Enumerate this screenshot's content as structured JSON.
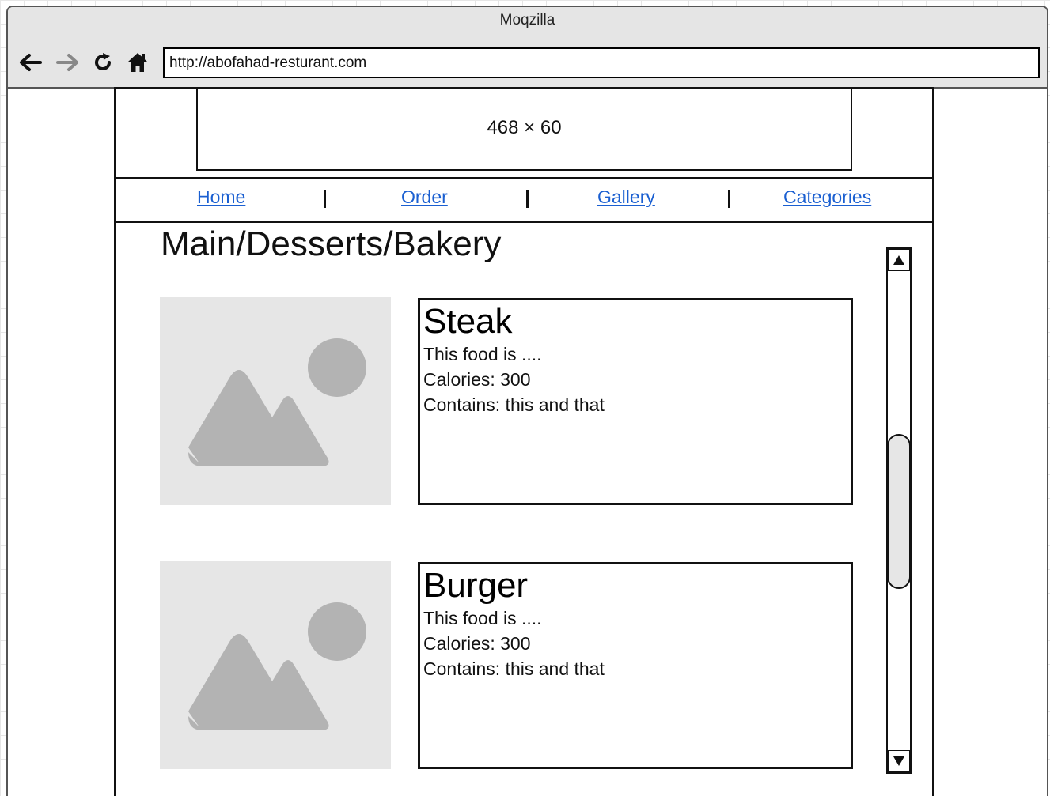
{
  "window": {
    "title": "Moqzilla"
  },
  "toolbar": {
    "back_icon": "back-arrow-icon",
    "forward_icon": "forward-arrow-icon",
    "reload_icon": "reload-icon",
    "home_icon": "home-icon",
    "url": "http://abofahad-resturant.com"
  },
  "banner": {
    "label": "468 × 60"
  },
  "nav": {
    "items": [
      {
        "label": "Home"
      },
      {
        "label": "Order"
      },
      {
        "label": "Gallery"
      },
      {
        "label": "Categories"
      }
    ]
  },
  "breadcrumb": "Main/Desserts/Bakery",
  "foods": [
    {
      "name": "Steak",
      "description": "This food is ....",
      "calories": "Calories: 300",
      "contains": "Contains: this and that",
      "image_icon": "image-placeholder-icon"
    },
    {
      "name": "Burger",
      "description": "This food is ....",
      "calories": "Calories: 300",
      "contains": "Contains: this and that",
      "image_icon": "image-placeholder-icon"
    }
  ],
  "scrollbar": {
    "up_icon": "scroll-up-icon",
    "down_icon": "scroll-down-icon"
  },
  "colors": {
    "link": "#1a5fd1",
    "titlebar": "#e5e5e5",
    "placeholder_bg": "#e6e6e6",
    "placeholder_fg": "#b3b3b3"
  }
}
